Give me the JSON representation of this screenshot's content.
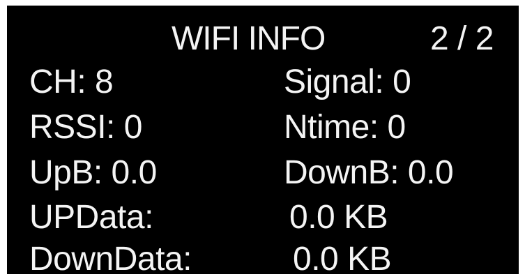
{
  "header": {
    "title": "WIFI INFO",
    "page_indicator": "2 / 2"
  },
  "rows": {
    "ch": "CH: 8",
    "signal": "Signal: 0",
    "rssi": "RSSI: 0",
    "ntime": "Ntime: 0",
    "upb": "UpB: 0.0",
    "downb": "DownB: 0.0",
    "updata_label": "UPData:",
    "updata_value": "0.0 KB",
    "downdata_label": "DownData:",
    "downdata_value": "0.0 KB"
  },
  "colors": {
    "screen_background": "#000000",
    "text": "#f4f4f4",
    "frame": "#ffffff"
  }
}
